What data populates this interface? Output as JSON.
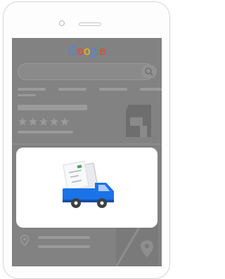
{
  "app": {
    "logo_text": "Google",
    "logo_letters": [
      {
        "char": "G",
        "color": "#4285F4"
      },
      {
        "char": "o",
        "color": "#EA4335"
      },
      {
        "char": "o",
        "color": "#FBBC05"
      },
      {
        "char": "g",
        "color": "#4285F4"
      },
      {
        "char": "l",
        "color": "#34A853"
      },
      {
        "char": "e",
        "color": "#EA4335"
      }
    ]
  },
  "overlay": {
    "illustration": "mail-delivery-truck-icon",
    "colors": {
      "truck": "#1A73E8",
      "truck_dark": "#174EA6",
      "envelope": "#E8EAED",
      "card": "#F1F3F4",
      "stamp": "#34A853",
      "wheel": "#3C4043"
    }
  },
  "listing": {
    "rating_stars": 5,
    "icons": [
      "storefront-icon",
      "location-pin-icon",
      "map-icon",
      "search-icon"
    ]
  }
}
